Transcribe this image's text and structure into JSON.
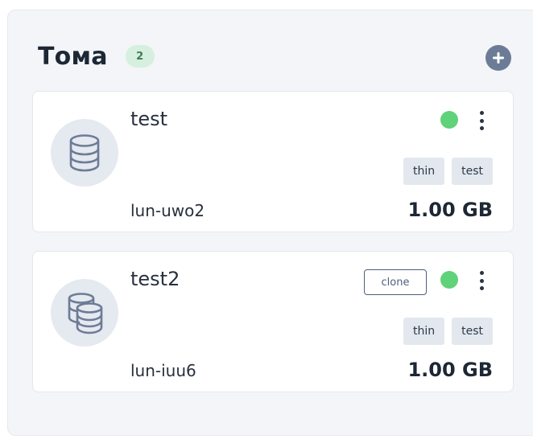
{
  "header": {
    "title": "Тома",
    "count": "2"
  },
  "volumes": [
    {
      "name": "test",
      "lun": "lun-uwo2",
      "size": "1.00 GB",
      "tags": [
        "thin",
        "test"
      ],
      "status_color": "#5fd27a",
      "icon": "database-icon"
    },
    {
      "name": "test2",
      "lun": "lun-iuu6",
      "size": "1.00 GB",
      "tags": [
        "thin",
        "test"
      ],
      "clone_label": "clone",
      "status_color": "#5fd27a",
      "icon": "database-stack-icon"
    }
  ]
}
